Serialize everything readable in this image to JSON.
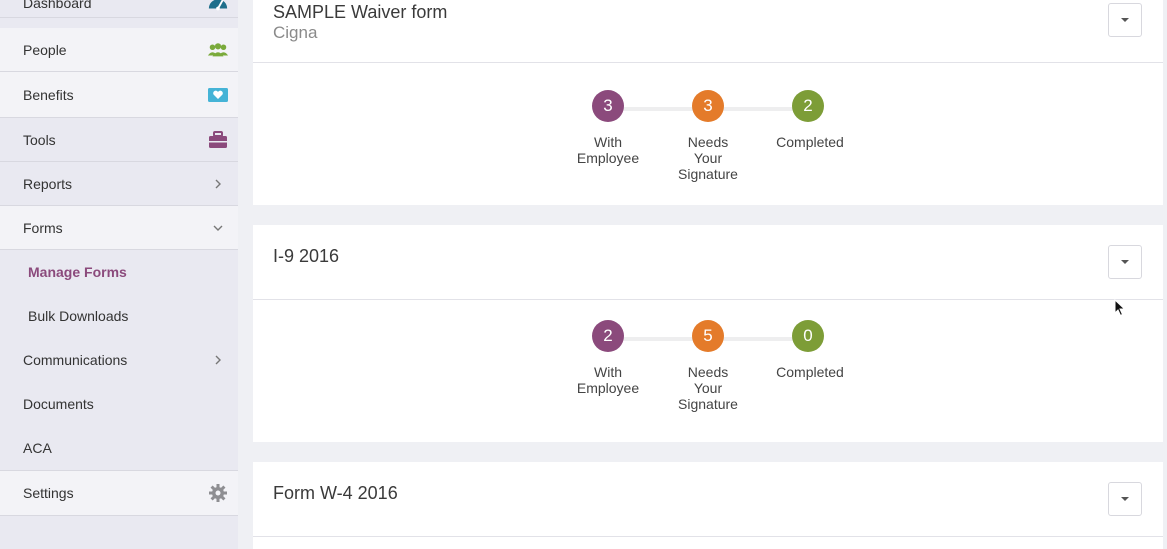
{
  "sidebar": {
    "items": [
      {
        "label": "Dashboard",
        "icon": "dashboard-gauge-icon"
      },
      {
        "label": "People",
        "icon": "people-icon"
      },
      {
        "label": "Benefits",
        "icon": "benefits-heart-card-icon"
      },
      {
        "label": "Tools",
        "icon": "toolbox-icon"
      },
      {
        "label": "Reports",
        "icon": "chevron-right-icon"
      },
      {
        "label": "Forms",
        "icon": "chevron-down-icon"
      },
      {
        "label": "Communications",
        "icon": "chevron-right-icon"
      },
      {
        "label": "Documents"
      },
      {
        "label": "ACA"
      },
      {
        "label": "Settings",
        "icon": "gear-icon"
      }
    ],
    "forms_subitems": [
      {
        "label": "Manage Forms",
        "active": true
      },
      {
        "label": "Bulk Downloads",
        "active": false
      }
    ]
  },
  "cards": [
    {
      "title": "SAMPLE Waiver form",
      "subtitle": "Cigna",
      "steps": [
        {
          "count": "3",
          "label1": "With",
          "label2": "Employee",
          "label3": ""
        },
        {
          "count": "3",
          "label1": "Needs",
          "label2": "Your",
          "label3": "Signature"
        },
        {
          "count": "2",
          "label1": "Completed",
          "label2": "",
          "label3": ""
        }
      ]
    },
    {
      "title": "I-9 2016",
      "steps": [
        {
          "count": "2",
          "label1": "With",
          "label2": "Employee",
          "label3": ""
        },
        {
          "count": "5",
          "label1": "Needs",
          "label2": "Your",
          "label3": "Signature"
        },
        {
          "count": "0",
          "label1": "Completed",
          "label2": "",
          "label3": ""
        }
      ]
    },
    {
      "title": "Form W-4 2016"
    }
  ],
  "colors": {
    "with_employee": "#8b4a7c",
    "needs_signature": "#e47b2a",
    "completed": "#7d9d37",
    "accent": "#8b4a7c"
  }
}
